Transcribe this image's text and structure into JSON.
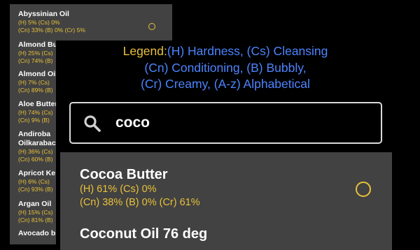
{
  "background_list": {
    "items": [
      {
        "name": "Abyssinian Oil",
        "line1": "(H) 5% (Cs) 0%",
        "line2": "(Cn) 33% (B) 0% (Cr) 5%"
      },
      {
        "name": "Almond Bu",
        "line1": "(H) 25% (Cs)",
        "line2": "(Cn) 74% (B)"
      },
      {
        "name": "Almond Oil",
        "line1": "(H) 7% (Cs)",
        "line2": "(Cn) 89% (B)"
      },
      {
        "name": "Aloe Butter",
        "line1": "(H) 74% (Cs)",
        "line2": "(Cn) 9% (B)"
      },
      {
        "name": "Andiroba",
        "name2": "Oilkarabac",
        "line1": "(H) 36% (Cs)",
        "line2": "(Cn) 60% (B)"
      },
      {
        "name": "Apricot Ke",
        "line1": "(H) 6% (Cs)",
        "line2": "(Cn) 93% (B)"
      },
      {
        "name": "Argan Oil",
        "line1": "(H) 15% (Cs)",
        "line2": "(Cn) 81% (B)"
      },
      {
        "name": "Avocado b"
      }
    ]
  },
  "legend": {
    "label": "Legend:",
    "line1": "(H) Hardness, (Cs) Cleansing",
    "line2": "(Cn) Conditioning, (B) Bubbly,",
    "line3": "(Cr) Creamy, (A-z) Alphabetical"
  },
  "search": {
    "value": "coco",
    "icon": "search-icon"
  },
  "results": [
    {
      "name": "Cocoa Butter",
      "line1": "(H) 61% (Cs) 0%",
      "line2": "(Cn) 38% (B) 0% (Cr) 61%"
    },
    {
      "name": "Coconut Oil 76 deg"
    }
  ],
  "colors": {
    "stat_yellow": "#e8c13a",
    "legend_blue": "#4c84ff",
    "panel_gray": "#424242",
    "background": "#000000"
  }
}
